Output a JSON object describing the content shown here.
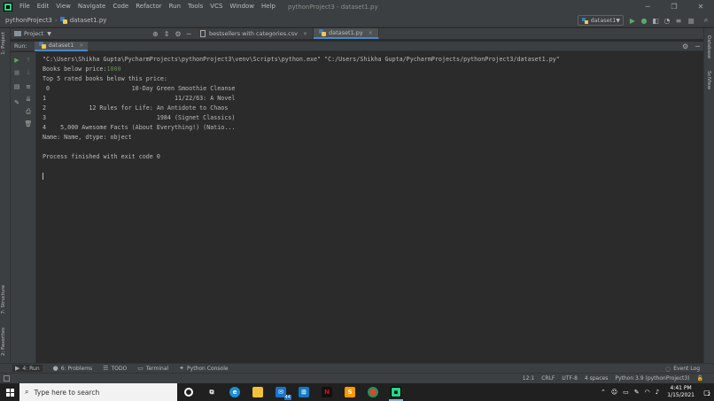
{
  "menubar": {
    "items": [
      "File",
      "Edit",
      "View",
      "Navigate",
      "Code",
      "Refactor",
      "Run",
      "Tools",
      "VCS",
      "Window",
      "Help"
    ],
    "window_title": "pythonProject3 - dataset1.py",
    "controls": [
      "─",
      "❐",
      "✕"
    ]
  },
  "navbar": {
    "project": "pythonProject3",
    "file": "dataset1.py",
    "run_config": "dataset1"
  },
  "project_panel": {
    "label": "Project"
  },
  "editor_tabs": [
    {
      "label": "bestsellers with categories.csv"
    },
    {
      "label": "dataset1.py"
    }
  ],
  "left_strip": {
    "project": "1: Project",
    "structure": "7: Structure",
    "favorites": "2: Favorites"
  },
  "right_strip": {
    "database": "Database",
    "sciview": "SciView"
  },
  "run_panel": {
    "label": "Run:",
    "tab": "dataset1"
  },
  "console": {
    "command": "\"C:\\Users\\Shikha Gupta\\PycharmProjects\\pythonProject3\\venv\\Scripts\\python.exe\" \"C:/Users/Shikha Gupta/PycharmProjects/pythonProject3/dataset1.py\"",
    "prompt_label": "Books below price:",
    "prompt_input": "1000",
    "top_label": "Top 5 rated books below this price:",
    "rows": [
      " 0                       10-Day Green Smoothie Cleanse",
      "1                                    11/22/63: A Novel",
      "2            12 Rules for Life: An Antidote to Chaos",
      "3                               1984 (Signet Classics)",
      "4    5,000 Awesome Facts (About Everything!) (Natio..."
    ],
    "dtype_line": "Name: Name, dtype: object",
    "exit_line": "Process finished with exit code 0"
  },
  "bottom_tools": {
    "run": "4: Run",
    "problems": "6: Problems",
    "todo": "TODO",
    "terminal": "Terminal",
    "python_console": "Python Console",
    "event_log": "Event Log"
  },
  "statusbar": {
    "position": "12:1",
    "line_sep": "CRLF",
    "encoding": "UTF-8",
    "indent": "4 spaces",
    "interpreter": "Python 3.9 (pythonProject3)"
  },
  "taskbar": {
    "search_placeholder": "Type here to search",
    "mail_badge": "44",
    "time": "4:41 PM",
    "date": "1/15/2021",
    "notif_badge": "2"
  }
}
